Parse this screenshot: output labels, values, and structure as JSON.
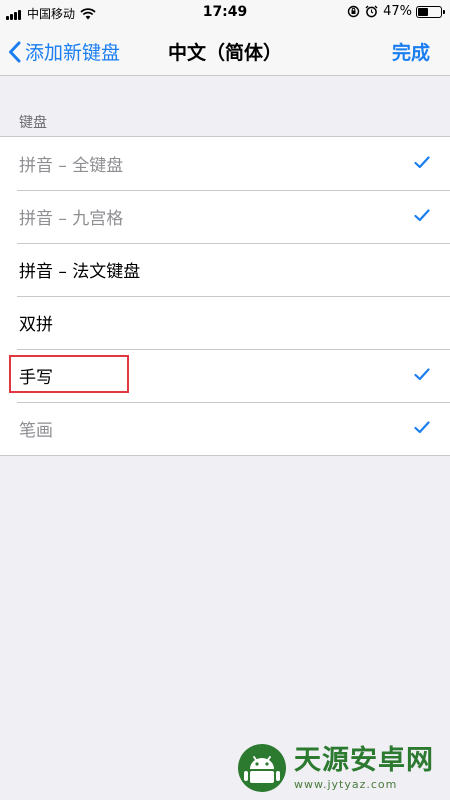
{
  "status_bar": {
    "carrier": "中国移动",
    "time": "17:49",
    "battery_percent": "47%",
    "battery_level": 0.47
  },
  "nav": {
    "back_label": "添加新键盘",
    "title": "中文（简体）",
    "done_label": "完成"
  },
  "section": {
    "header": "键盘",
    "items": [
      {
        "label": "拼音 – 全键盘",
        "checked": true,
        "dimmed": true
      },
      {
        "label": "拼音 – 九宫格",
        "checked": true,
        "dimmed": true
      },
      {
        "label": "拼音 – 法文键盘",
        "checked": false,
        "dimmed": false
      },
      {
        "label": "双拼",
        "checked": false,
        "dimmed": false
      },
      {
        "label": "手写",
        "checked": true,
        "dimmed": false,
        "highlighted": true
      },
      {
        "label": "笔画",
        "checked": true,
        "dimmed": true
      }
    ]
  },
  "watermark": {
    "name": "天源安卓网",
    "url": "www.jytyaz.com"
  },
  "colors": {
    "accent": "#1a7ef1",
    "highlight_box": "#e0383e",
    "background": "#efeff4",
    "watermark_green": "#2c7a2f"
  }
}
